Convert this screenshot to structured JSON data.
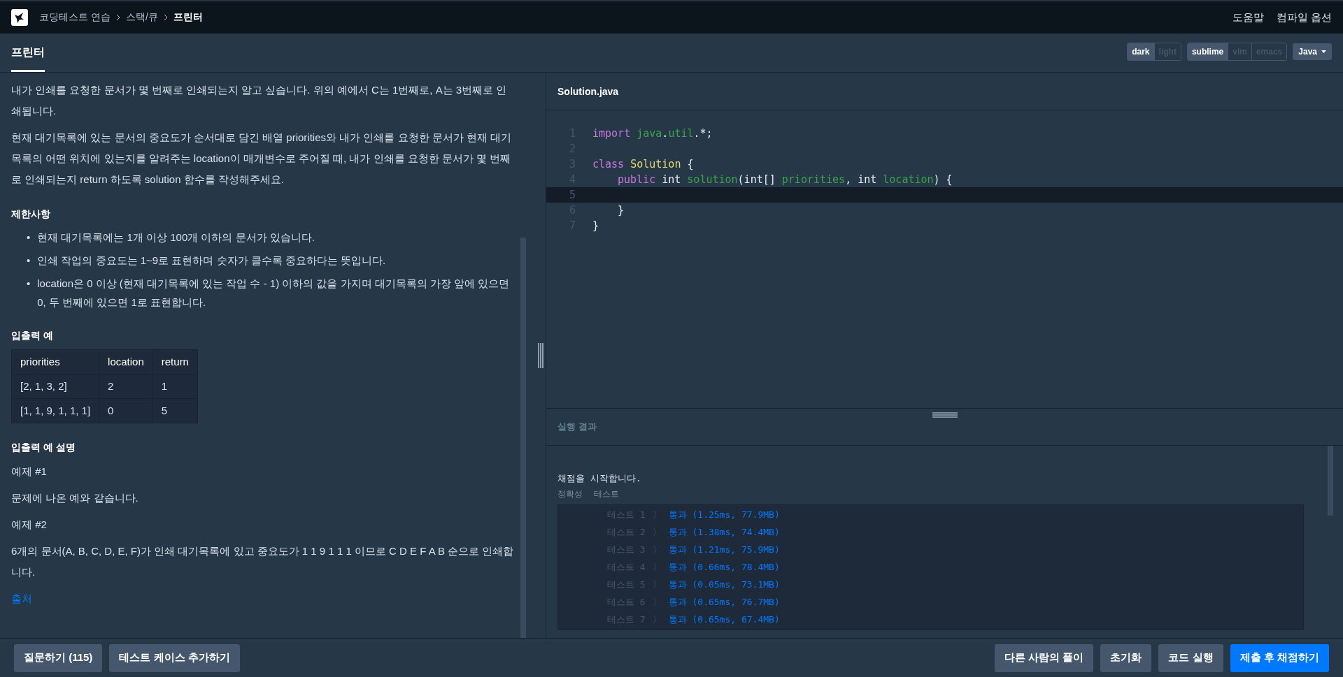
{
  "nav": {
    "breadcrumbs": [
      {
        "label": "코딩테스트 연습",
        "current": false
      },
      {
        "label": "스택/큐",
        "current": false
      },
      {
        "label": "프린터",
        "current": true
      }
    ],
    "links": [
      "도움말",
      "컴파일 옵션"
    ]
  },
  "tab": {
    "label": "프린터",
    "selected": true
  },
  "theme_toggle": [
    {
      "label": "dark",
      "selected": true
    },
    {
      "label": "light",
      "selected": false
    }
  ],
  "keymap_toggle": [
    {
      "label": "sublime",
      "selected": true
    },
    {
      "label": "vim",
      "selected": false
    },
    {
      "label": "emacs",
      "selected": false
    }
  ],
  "language": {
    "label": "Java"
  },
  "problem": {
    "intro": [
      "내가 인쇄를 요청한 문서가 몇 번째로 인쇄되는지 알고 싶습니다. 위의 예에서 C는 1번째로, A는 3번째로 인쇄됩니다.",
      "현재 대기목록에 있는 문서의 중요도가 순서대로 담긴 배열 priorities와 내가 인쇄를 요청한 문서가 현재 대기목록의 어떤 위치에 있는지를 알려주는 location이 매개변수로 주어질 때, 내가 인쇄를 요청한 문서가 몇 번째로 인쇄되는지 return 하도록 solution 함수를 작성해주세요."
    ],
    "constraints_title": "제한사항",
    "constraints_bullet": "•",
    "constraints": [
      "현재 대기목록에는 1개 이상 100개 이하의 문서가 있습니다.",
      "인쇄 작업의 중요도는 1~9로 표현하며 숫자가 클수록 중요하다는 뜻입니다.",
      "location은 0 이상 (현재 대기목록에 있는 작업 수 - 1) 이하의 값을 가지며 대기목록의 가장 앞에 있으면 0, 두 번째에 있으면 1로 표현합니다."
    ],
    "examples_title": "입출력 예",
    "table": {
      "columns": [
        "priorities",
        "location",
        "return"
      ],
      "rows": [
        [
          "[2, 1, 3, 2]",
          "2",
          "1"
        ],
        [
          "[1, 1, 9, 1, 1, 1]",
          "0",
          "5"
        ]
      ]
    },
    "explanation_title": "입출력 예 설명",
    "explanation": [
      "예제 #1",
      "문제에 나온 예와 같습니다.",
      "예제 #2",
      "6개의 문서(A, B, C, D, E, F)가 인쇄 대기목록에 있고 중요도가 1 1 9 1 1 1 이므로 C D E F A B 순으로 인쇄합니다."
    ],
    "source_link": "출처"
  },
  "editor": {
    "filename": "Solution.java",
    "lines": [
      {
        "number": "1",
        "current": false,
        "indented": false,
        "tokens": [
          {
            "text": "import",
            "kind": "keyword"
          },
          {
            "text": " java",
            "kind": "name"
          },
          {
            "text": ".",
            "kind": "plain"
          },
          {
            "text": "util",
            "kind": "name"
          },
          {
            "text": ".*;",
            "kind": "plain"
          }
        ]
      },
      {
        "number": "2",
        "current": false
      },
      {
        "number": "3",
        "current": false,
        "indented": false,
        "tokens": [
          {
            "text": "class",
            "kind": "keyword"
          },
          {
            "text": " Solution",
            "kind": "class"
          },
          {
            "text": " {",
            "kind": "plain"
          }
        ]
      },
      {
        "number": "4",
        "current": false,
        "indented": true,
        "tokens": [
          {
            "text": "public",
            "kind": "keyword"
          },
          {
            "text": " int ",
            "kind": "plain"
          },
          {
            "text": "solution",
            "kind": "name"
          },
          {
            "text": "(int[] ",
            "kind": "plain"
          },
          {
            "text": "priorities",
            "kind": "name"
          },
          {
            "text": ", int ",
            "kind": "plain"
          },
          {
            "text": "location",
            "kind": "name"
          },
          {
            "text": ") {",
            "kind": "plain"
          }
        ]
      },
      {
        "number": "5",
        "current": true
      },
      {
        "number": "6",
        "current": false,
        "indented": true,
        "tokens": [
          {
            "text": "}",
            "kind": "plain"
          }
        ]
      },
      {
        "number": "7",
        "current": false,
        "indented": false,
        "tokens": [
          {
            "text": "}",
            "kind": "plain"
          }
        ]
      }
    ]
  },
  "result": {
    "title": "실행 결과",
    "message": "채점을 시작합니다.",
    "group_labels": [
      "정확성",
      "테스트"
    ],
    "tests": [
      {
        "label": "테스트 1",
        "arrow": "〉",
        "outcome": "통과 (1.25ms, 77.9MB)"
      },
      {
        "label": "테스트 2",
        "arrow": "〉",
        "outcome": "통과 (1.38ms, 74.4MB)"
      },
      {
        "label": "테스트 3",
        "arrow": "〉",
        "outcome": "통과 (1.21ms, 75.9MB)"
      },
      {
        "label": "테스트 4",
        "arrow": "〉",
        "outcome": "통과 (0.66ms, 78.4MB)"
      },
      {
        "label": "테스트 5",
        "arrow": "〉",
        "outcome": "통과 (0.05ms, 73.1MB)"
      },
      {
        "label": "테스트 6",
        "arrow": "〉",
        "outcome": "통과 (0.65ms, 76.7MB)"
      },
      {
        "label": "테스트 7",
        "arrow": "〉",
        "outcome": "통과 (0.65ms, 67.4MB)"
      }
    ]
  },
  "footer": {
    "left_buttons": [
      {
        "label": "질문하기 (115)",
        "kind": "secondary"
      },
      {
        "label": "테스트 케이스 추가하기",
        "kind": "secondary"
      }
    ],
    "right_buttons": [
      {
        "label": "다른 사람의 풀이",
        "kind": "secondary"
      },
      {
        "label": "초기화",
        "kind": "secondary"
      },
      {
        "label": "코드 실행",
        "kind": "secondary"
      },
      {
        "label": "제출 후 채점하기",
        "kind": "primary"
      }
    ]
  }
}
